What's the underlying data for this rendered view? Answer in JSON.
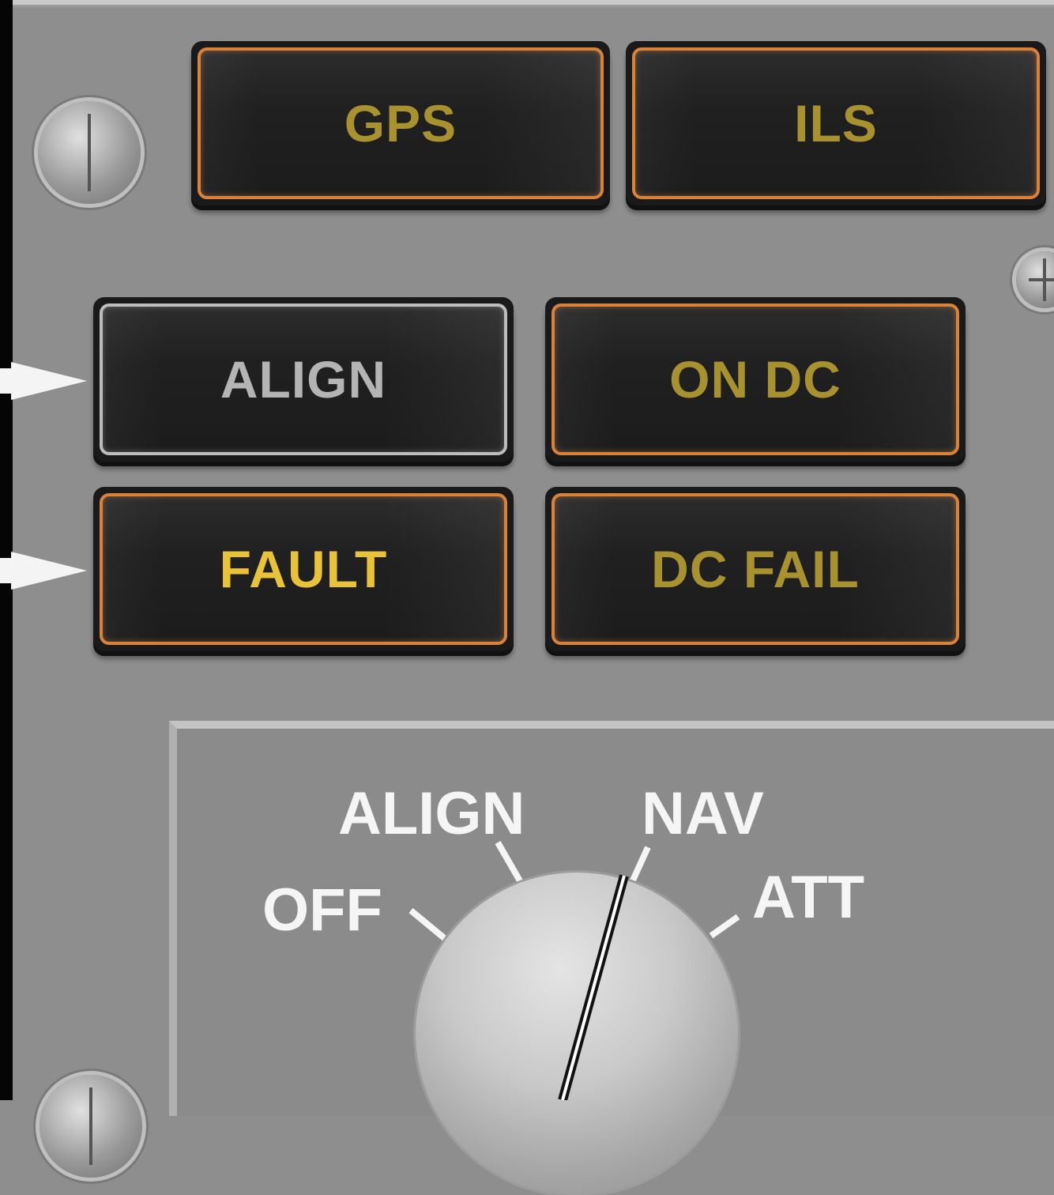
{
  "annunciators": [
    {
      "label": "GPS",
      "state": "amber-dim"
    },
    {
      "label": "ILS",
      "state": "amber-dim"
    },
    {
      "label": "ALIGN",
      "state": "white-dim"
    },
    {
      "label": "ON DC",
      "state": "amber-dim"
    },
    {
      "label": "FAULT",
      "state": "amber-lit"
    },
    {
      "label": "DC FAIL",
      "state": "amber-dim"
    }
  ],
  "mode_selector": {
    "positions": [
      "OFF",
      "ALIGN",
      "NAV",
      "ATT"
    ],
    "selected": "NAV"
  },
  "colors": {
    "panel": "#8e8e8e",
    "amber_border": "#d9823a",
    "amber_text_dim": "#a8912f",
    "amber_text_lit": "#e8c33a",
    "white_border": "#bdbdbd"
  }
}
